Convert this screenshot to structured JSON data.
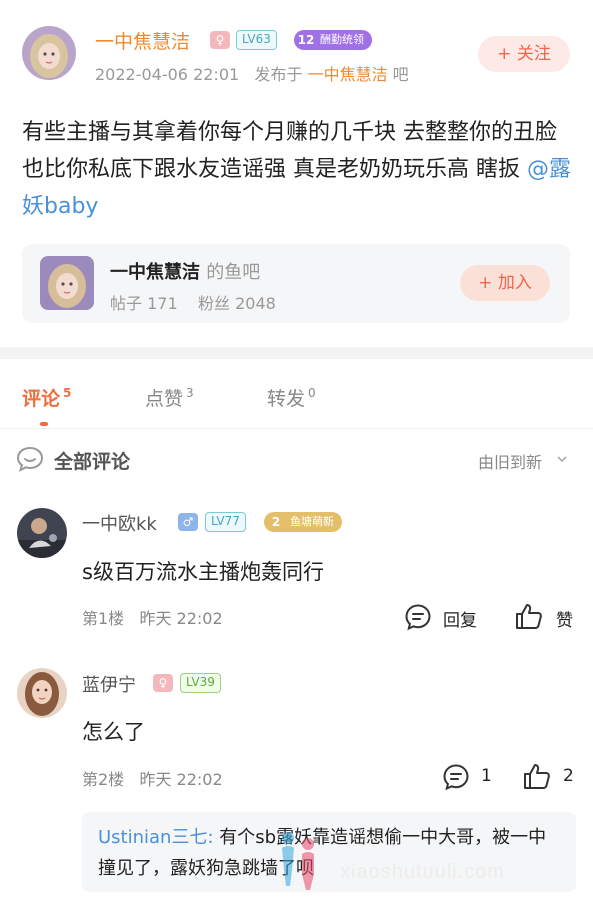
{
  "post": {
    "author": "一中焦慧洁",
    "gender_icon": "female-icon",
    "level": "LV63",
    "fan_badge_level": "12",
    "fan_badge_name": "酬勤统领",
    "date": "2022-04-06 22:01",
    "posted_in_prefix": "发布于",
    "bar_name": "一中焦慧洁",
    "bar_suffix": "吧",
    "follow_label": "+ 关注",
    "body_text": "有些主播与其拿着你每个月赚的几千块 去整整你的丑脸 也比你私底下跟水友造谣强 真是老奶奶玩乐高 瞎扳",
    "mention": "@露妖baby"
  },
  "bar_card": {
    "name": "一中焦慧洁",
    "suffix": "的鱼吧",
    "posts_label": "帖子",
    "posts_count": "171",
    "fans_label": "粉丝",
    "fans_count": "2048",
    "join_label": "+ 加入"
  },
  "tabs": [
    {
      "label": "评论",
      "count": "5",
      "active": true
    },
    {
      "label": "点赞",
      "count": "3",
      "active": false
    },
    {
      "label": "转发",
      "count": "0",
      "active": false
    }
  ],
  "comments_header": {
    "title": "全部评论",
    "sort_label": "由旧到新"
  },
  "comments": [
    {
      "name": "一中欧kk",
      "gender_icon": "male-icon",
      "level": "LV77",
      "fan_badge_level": "2",
      "fan_badge_name": "鱼塘萌新",
      "text": "s级百万流水主播炮轰同行",
      "floor": "第1楼",
      "time": "昨天 22:02",
      "reply_label": "回复",
      "like_label": "赞"
    },
    {
      "name": "蓝伊宁",
      "gender_icon": "female-icon",
      "level": "LV39",
      "text": "怎么了",
      "floor": "第2楼",
      "time": "昨天 22:02",
      "reply_count": "1",
      "like_count": "2",
      "reply": {
        "name": "Ustinian三七:",
        "text": "有个sb露妖靠造谣想偷一中大哥，被一中撞见了，露妖狗急跳墙了呗"
      }
    }
  ],
  "watermark_text": "xiaoshutuuli.com",
  "colors": {
    "accent": "#f06e3d",
    "author_orange": "#f08a30",
    "mention_blue": "#4a90d9",
    "fan_badge_purple": "#a071e6",
    "fan_badge_gold": "#e3bf6a"
  }
}
